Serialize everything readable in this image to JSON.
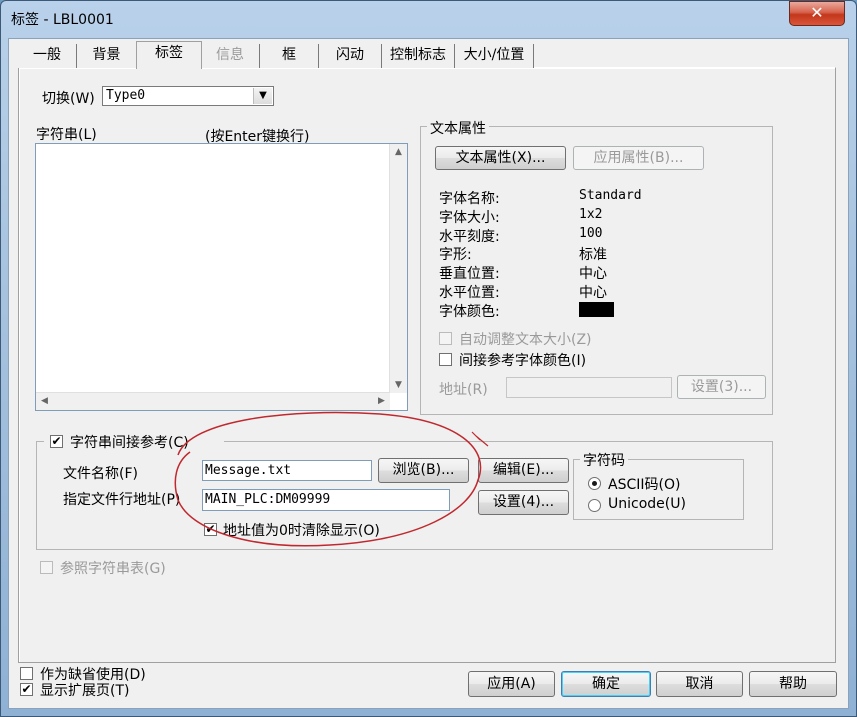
{
  "window": {
    "title": "标签 - LBL0001",
    "close_glyph": "✕"
  },
  "tabs": [
    {
      "label": "一般",
      "state": "normal"
    },
    {
      "label": "背景",
      "state": "normal"
    },
    {
      "label": "标签",
      "state": "active"
    },
    {
      "label": "信息",
      "state": "disabled"
    },
    {
      "label": "框",
      "state": "normal"
    },
    {
      "label": "闪动",
      "state": "normal"
    },
    {
      "label": "控制标志",
      "state": "normal"
    },
    {
      "label": "大小/位置",
      "state": "normal"
    }
  ],
  "switch": {
    "label": "切换(W)",
    "value": "Type0"
  },
  "string": {
    "label": "字符串(L)",
    "hint": "(按Enter键换行)",
    "value": ""
  },
  "text_props": {
    "group_title": "文本属性",
    "text_attr_button": "文本属性(X)...",
    "apply_attr_button": "应用属性(B)...",
    "rows": [
      {
        "name": "字体名称:",
        "value": "Standard"
      },
      {
        "name": "字体大小:",
        "value": "1x2"
      },
      {
        "name": "水平刻度:",
        "value": "100"
      },
      {
        "name": "字形:",
        "value": "标准"
      },
      {
        "name": "垂直位置:",
        "value": "中心"
      },
      {
        "name": "水平位置:",
        "value": "中心"
      },
      {
        "name": "字体颜色:",
        "value": ""
      }
    ],
    "font_color": "#000000",
    "auto_adjust": {
      "label": "自动调整文本大小(Z)",
      "checked": false,
      "enabled": false
    },
    "indirect_color": {
      "label": "间接参考字体颜色(I)",
      "checked": false
    },
    "address_label": "地址(R)",
    "address_value": "",
    "settings_button": "设置(3)..."
  },
  "indirect": {
    "checkbox_label": "字符串间接参考(C)",
    "checked": true,
    "file_name_label": "文件名称(F)",
    "file_name_value": "Message.txt",
    "browse_button": "浏览(B)...",
    "edit_button": "编辑(E)...",
    "line_addr_label": "指定文件行地址(P)",
    "line_addr_value": "MAIN_PLC:DM09999",
    "settings_button": "设置(4)...",
    "clear_label": "地址值为0时清除显示(O)",
    "clear_checked": true
  },
  "charcode": {
    "group_title": "字符码",
    "options": [
      {
        "label": "ASCII码(O)",
        "selected": true
      },
      {
        "label": "Unicode(U)",
        "selected": false
      }
    ]
  },
  "ref_table": {
    "label": "参照字符串表(G)",
    "checked": false,
    "enabled": false
  },
  "footer": {
    "default_use": {
      "label": "作为缺省使用(D)",
      "checked": false
    },
    "show_ext": {
      "label": "显示扩展页(T)",
      "checked": true
    },
    "apply": "应用(A)",
    "ok": "确定",
    "cancel": "取消",
    "help": "帮助"
  },
  "check_glyph": "✔",
  "dropdown_glyph": "▼",
  "scroll_up_glyph": "▲",
  "scroll_down_glyph": "▼",
  "scroll_left_glyph": "◀",
  "scroll_right_glyph": "▶",
  "annotation_color": "#c0282e"
}
